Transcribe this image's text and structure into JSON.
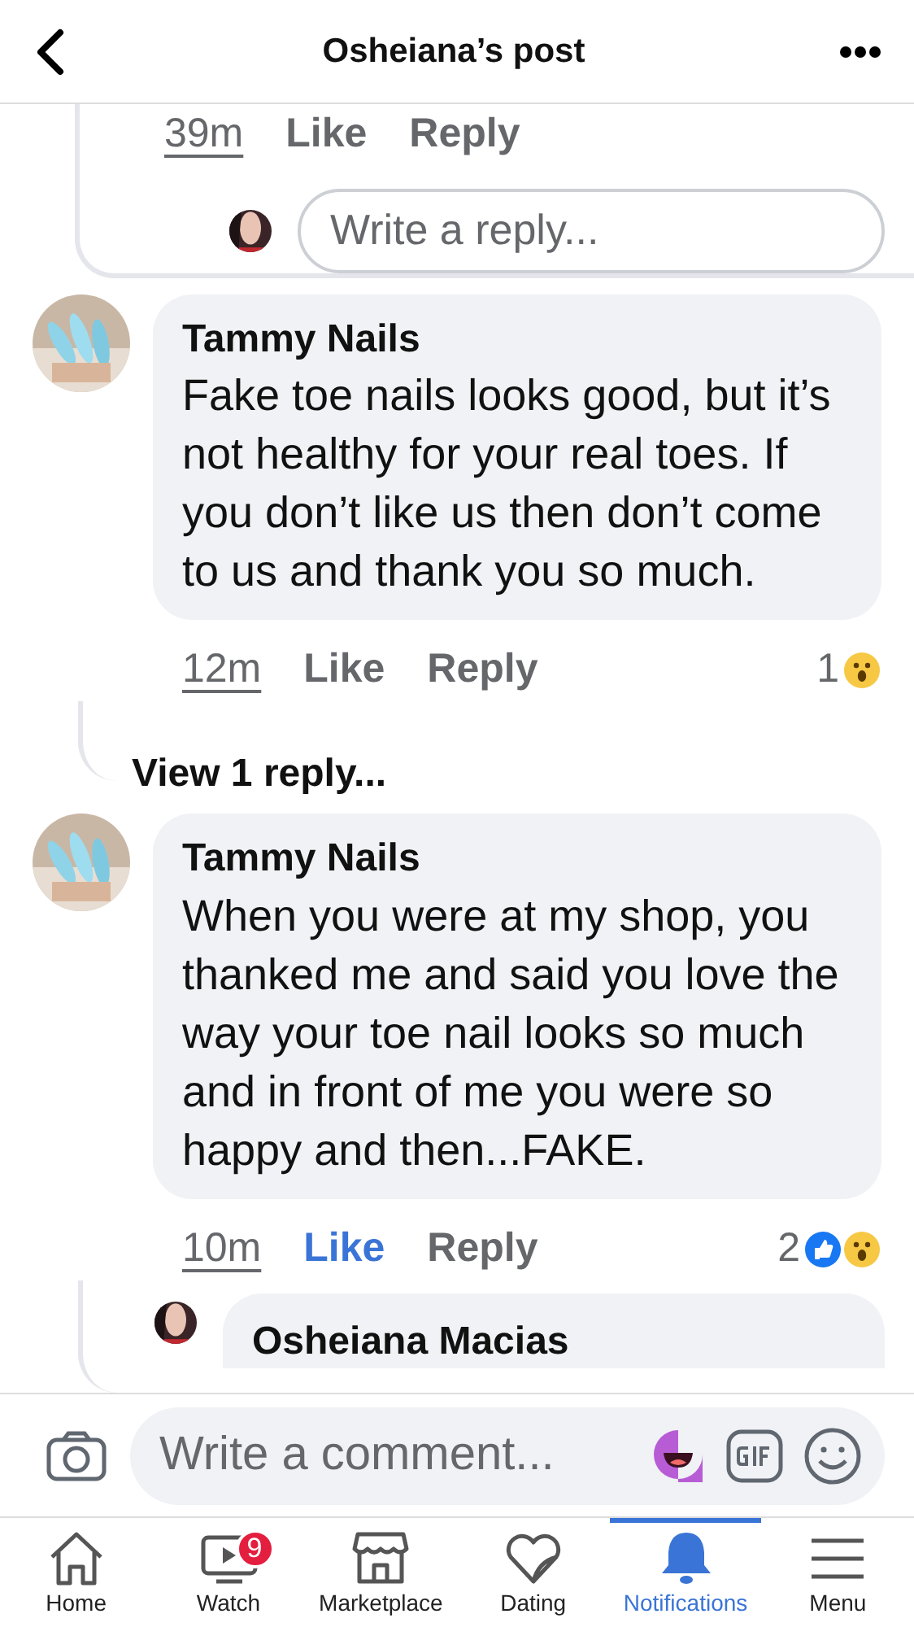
{
  "header": {
    "title": "Osheiana’s post"
  },
  "top_actions": {
    "time": "39m",
    "like": "Like",
    "liked": false,
    "reply": "Reply"
  },
  "reply_box": {
    "placeholder": "Write a reply..."
  },
  "comments": [
    {
      "author": "Tammy Nails",
      "text": "Fake toe nails looks good, but it’s not healthy for your real toes. If you don’t like us then don’t come to us and thank you so much.",
      "time": "12m",
      "like": "Like",
      "liked": false,
      "reply": "Reply",
      "reaction_count": "1",
      "reactions": [
        {
          "kind": "wow"
        }
      ],
      "view_replies": "View 1 reply..."
    },
    {
      "author": "Tammy Nails",
      "text": "When you were at my shop, you thanked me and said you love the way your toe nail looks so much and in front of me you were so happy and then...FAKE.",
      "time": "10m",
      "like": "Like",
      "liked": true,
      "reply": "Reply",
      "reaction_count": "2",
      "reactions": [
        {
          "kind": "like"
        },
        {
          "kind": "wow"
        }
      ]
    }
  ],
  "partial_reply": {
    "author": "Osheiana Macias"
  },
  "composer": {
    "placeholder": "Write a comment..."
  },
  "tabs": [
    {
      "label": "Home",
      "kind": "home",
      "selected": false
    },
    {
      "label": "Watch",
      "kind": "watch",
      "selected": false,
      "badge": "9"
    },
    {
      "label": "Marketplace",
      "kind": "market",
      "selected": false
    },
    {
      "label": "Dating",
      "kind": "heart",
      "selected": false
    },
    {
      "label": "Notifications",
      "kind": "bell",
      "selected": true
    },
    {
      "label": "Menu",
      "kind": "menu",
      "selected": false
    }
  ]
}
